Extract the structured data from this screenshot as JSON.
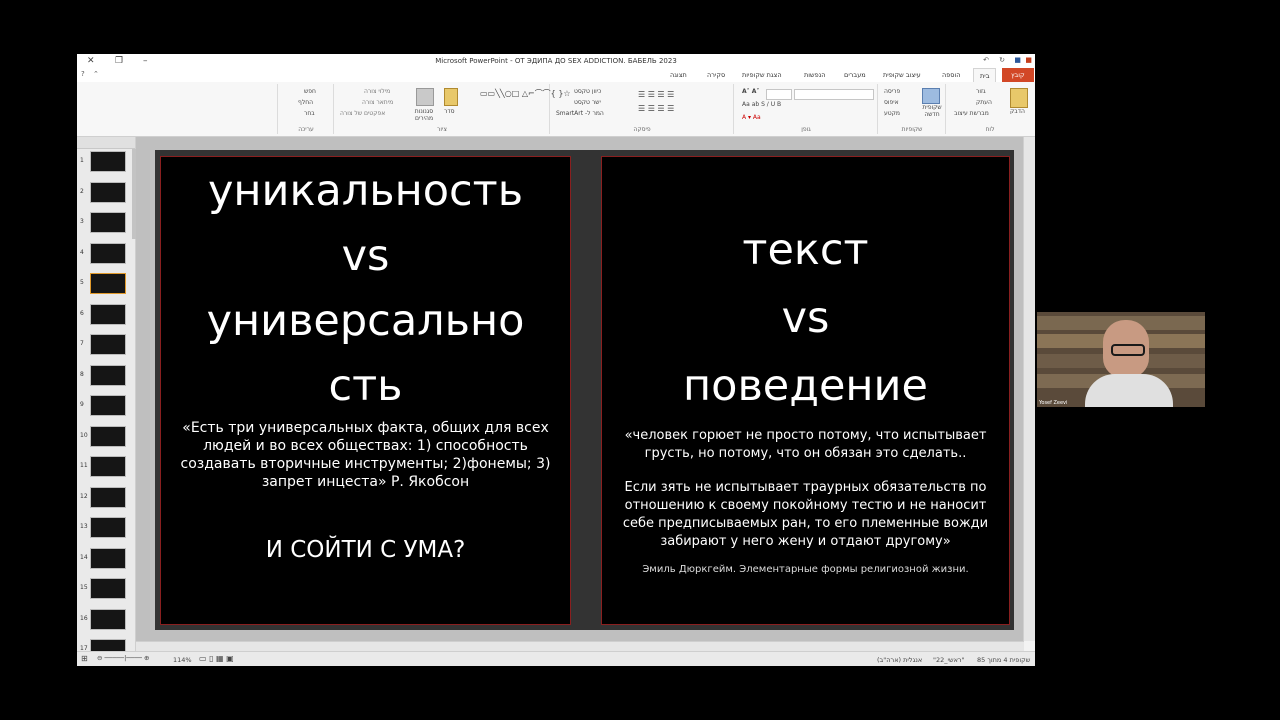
{
  "window": {
    "title": "Microsoft PowerPoint - ОТ ЭДИПА ДО SEX ADDICTION. БАБЕЛЬ 2023"
  },
  "ribbon_tabs": [
    "קובץ",
    "בית",
    "הוספה",
    "עיצוב שקופית",
    "מעברים",
    "הנפשות",
    "הצגת שקופיות",
    "סקירה",
    "תצוגה"
  ],
  "ribbon": {
    "clipboard": {
      "label": "לוח",
      "paste": "הדבק",
      "cut": "גזור",
      "copy": "העתק",
      "format_painter": "מברשת עיצוב"
    },
    "slides": {
      "label": "שקופיות",
      "new_slide": "שקופית חדשה",
      "layout": "פריסה",
      "reset": "איפוס",
      "section": "מקטע"
    },
    "font": {
      "label": "גופן"
    },
    "paragraph": {
      "label": "פיסקה",
      "text_direction": "כיוון טקסט",
      "align_text": "ישר טקסט",
      "smartart": "SmartArt -המר ל"
    },
    "drawing": {
      "label": "ציור",
      "arrange": "סדר",
      "quick_styles": "סגנונות מהירים",
      "shape_fill": "מילוי צורה",
      "shape_outline": "מיתאר צורה",
      "shape_effects": "אפקטים של צורה"
    },
    "editing": {
      "label": "עריכה",
      "find": "חפש",
      "replace": "החלף",
      "select": "בחר"
    }
  },
  "thumbnails": [
    1,
    2,
    3,
    4,
    5,
    6,
    7,
    8,
    9,
    10,
    11,
    12,
    13,
    14,
    15,
    16,
    17,
    18
  ],
  "slide": {
    "left": {
      "heading_1": "уникальность",
      "heading_2": "vs",
      "heading_3": "универсально",
      "heading_4": "сть",
      "quote": "«Есть три универсальных факта, общих для всех людей и во всех обществах: 1) способность создавать вторичные инструменты; 2)фонемы; 3) запрет инцеста»  Р. Якобсон",
      "question": "И СОЙТИ С УМА?"
    },
    "right": {
      "heading_1": "текст",
      "heading_2": "vs",
      "heading_3": "поведение",
      "quote_1": "«человек горюет не просто потому, что испытывает грусть, но потому, что он обязан это сделать..",
      "quote_2": "Если зять не испытывает траурных обязательств по отношению к своему покойному тестю и не наносит себе предписываемых ран, то его племенные вожди забирают у него жену и отдают другому»",
      "source": "Эмиль Дюркгейм. Элементарные формы религиозной жизни."
    }
  },
  "status": {
    "slide_count": "שקופית 4 מתוך 85",
    "theme": "\"ראשי_22\"",
    "language": "אנגלית (ארה\"ב)",
    "zoom": "114%"
  },
  "webcam": {
    "name": "Yosef Zeevi"
  }
}
